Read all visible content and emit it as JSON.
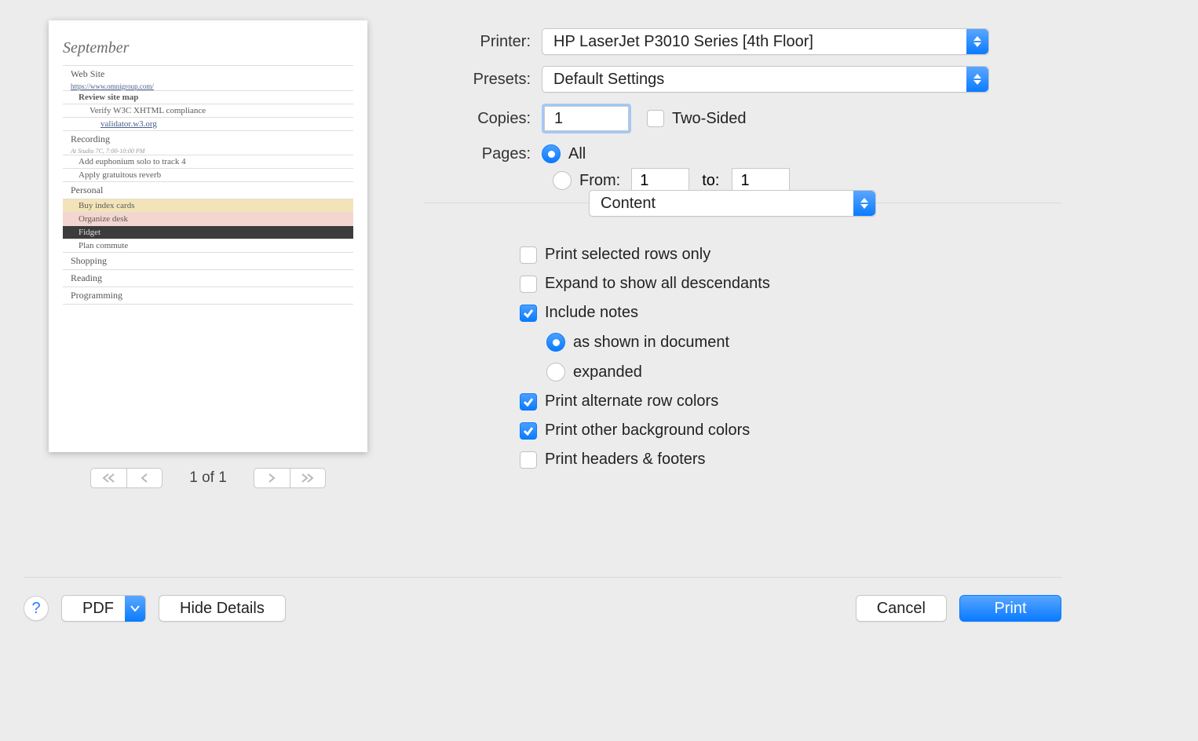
{
  "preview": {
    "title": "September",
    "sections": [
      {
        "label": "Web Site",
        "note_link": "https://www.omnigroup.com/",
        "items": [
          {
            "label": "Review site map",
            "bold": true,
            "children": [
              {
                "label": "Verify W3C XHTML compliance",
                "children": [
                  {
                    "label": "validator.w3.org",
                    "link": true
                  }
                ]
              }
            ]
          }
        ]
      },
      {
        "label": "Recording",
        "note": "At Studio 7C, 7:00-10:00 PM",
        "items": [
          {
            "label": "Add euphonium solo to track 4"
          },
          {
            "label": "Apply gratuitous reverb"
          }
        ]
      },
      {
        "label": "Personal",
        "items": [
          {
            "label": "Buy index cards",
            "class": "yellow"
          },
          {
            "label": "Organize desk",
            "class": "pink"
          },
          {
            "label": "Fidget",
            "class": "dark"
          },
          {
            "label": "Plan commute"
          }
        ]
      },
      {
        "label": "Shopping",
        "items": []
      },
      {
        "label": "Reading",
        "items": []
      },
      {
        "label": "Programming",
        "items": []
      }
    ],
    "page_indicator": "1 of 1"
  },
  "form": {
    "printer_label": "Printer:",
    "printer_value": "HP LaserJet P3010 Series [4th Floor]",
    "presets_label": "Presets:",
    "presets_value": "Default Settings",
    "copies_label": "Copies:",
    "copies_value": "1",
    "two_sided_label": "Two-Sided",
    "two_sided_checked": false,
    "pages_label": "Pages:",
    "pages_all_label": "All",
    "pages_all_on": true,
    "pages_from_label": "From:",
    "pages_from_value": "1",
    "pages_to_label": "to:",
    "pages_to_value": "1",
    "section_select": "Content",
    "opts": {
      "selected_rows": {
        "label": "Print selected rows only",
        "checked": false
      },
      "expand_desc": {
        "label": "Expand to show all descendants",
        "checked": false
      },
      "include_notes": {
        "label": "Include notes",
        "checked": true
      },
      "notes_as_shown": {
        "label": "as shown in document",
        "on": true
      },
      "notes_expanded": {
        "label": "expanded",
        "on": false
      },
      "alt_colors": {
        "label": "Print alternate row colors",
        "checked": true
      },
      "bg_colors": {
        "label": "Print other background colors",
        "checked": true
      },
      "headers_footers": {
        "label": "Print headers & footers",
        "checked": false
      }
    }
  },
  "footer": {
    "pdf_label": "PDF",
    "hide_details": "Hide Details",
    "cancel": "Cancel",
    "print": "Print"
  }
}
